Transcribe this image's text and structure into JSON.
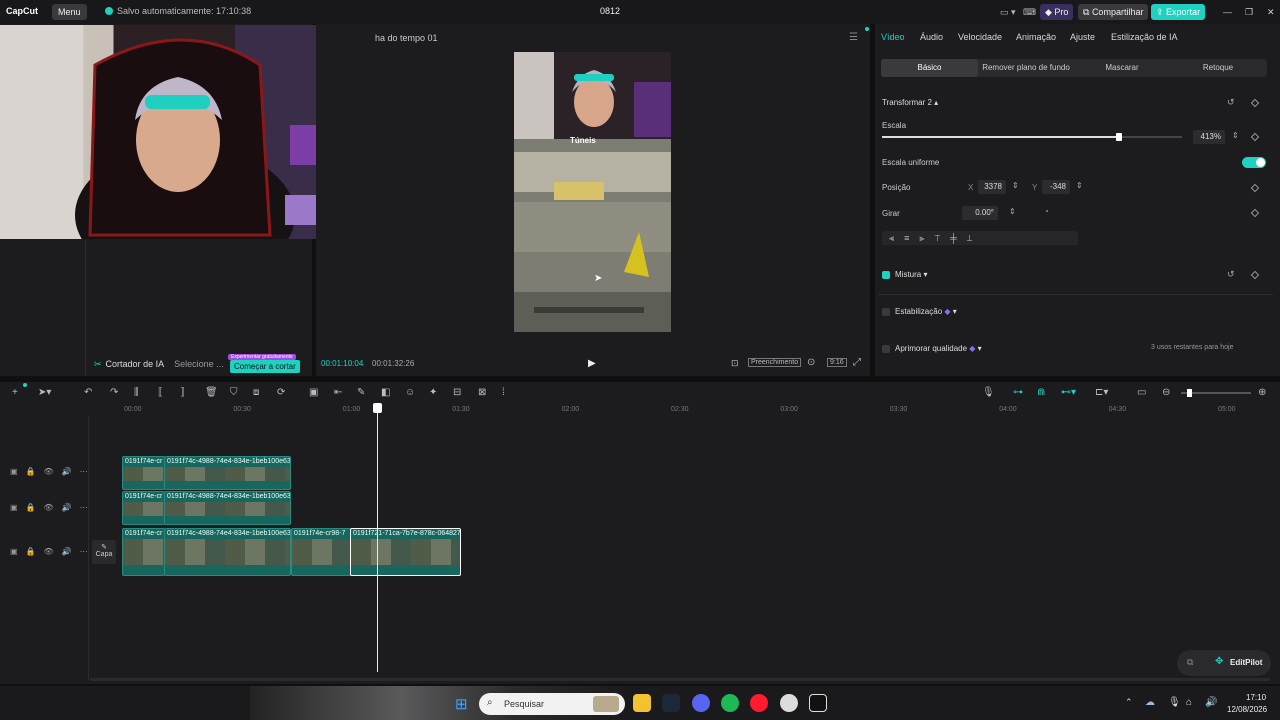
{
  "titlebar": {
    "logo": "CapCut",
    "menu_label": "Menu",
    "saved_status": "Salvo automaticamente: 17:10:38",
    "project_name": "0812",
    "pro_label": "Pro",
    "share_label": "Compartilhar",
    "export_label": "Exportar"
  },
  "media": {
    "ai_cutter_label": "Cortador de IA",
    "select_label": "Selecione ...",
    "trial_badge": "Experimentar gratuitamente",
    "start_cut_label": "Começar a cortar"
  },
  "player": {
    "title": "ha do tempo 01",
    "current_time": "00:01:10:04",
    "total_time": "00:01:32:26",
    "fill_label": "Preenchimento",
    "ratio_label": "9:16",
    "frame_text": "Túneis"
  },
  "props": {
    "tabs": [
      "Vídeo",
      "Áudio",
      "Velocidade",
      "Animação",
      "Ajuste",
      "Estilização de IA"
    ],
    "subtabs": [
      "Básico",
      "Remover plano de fundo",
      "Mascarar",
      "Retoque"
    ],
    "transform_label": "Transformar 2",
    "scale_label": "Escala",
    "scale_value": "413%",
    "scale_fraction": 0.79,
    "uniform_label": "Escala uniforme",
    "position_label": "Posição",
    "x_label": "X",
    "x_value": "3378",
    "y_label": "Y",
    "y_value": "-348",
    "rotate_label": "Girar",
    "rotate_value": "0.00°",
    "blend_label": "Mistura",
    "stabilize_label": "Estabilização",
    "enhance_label": "Aprimorar qualidade",
    "enhance_note": "3 usos restantes para hoje"
  },
  "timeline": {
    "ruler": [
      "00:00",
      "00:30",
      "01:00",
      "01:30",
      "02:00",
      "02:30",
      "03:00",
      "03:30",
      "04:00",
      "04:30",
      "05:00"
    ],
    "cover_label": "Capa",
    "clips": [
      {
        "label": "0191f74e-cr"
      },
      {
        "label": "0191f74c-4988-74e4-834e-1beb100e63"
      },
      {
        "label": "0191f74e-cr"
      },
      {
        "label": "0191f74c-4988-74e4-834e-1beb100e63"
      },
      {
        "label": "0191f74e-cr"
      },
      {
        "label": "0191f74c-4988-74e4-834e-1beb100e63"
      },
      {
        "label": "0191f74e-cr98-7"
      },
      {
        "label": "0191f721-71ca-7b7e-878c-0648277"
      }
    ]
  },
  "editpilot": {
    "label": "EditPilot"
  },
  "taskbar": {
    "search_placeholder": "Pesquisar",
    "time": "17:10",
    "date": "12/08/2026"
  },
  "colors": {
    "accent": "#1fd1c1",
    "clip": "#17675e",
    "export": "#1fd1c1",
    "pro": "#6a4cff"
  }
}
